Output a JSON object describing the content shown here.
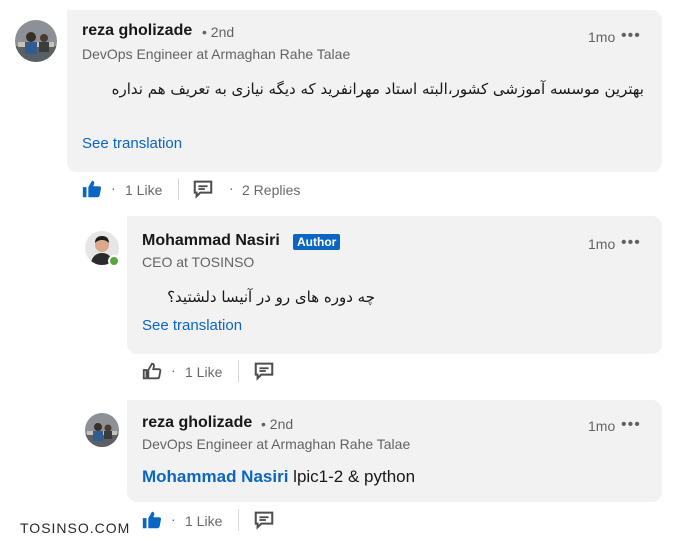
{
  "comments": [
    {
      "author": "reza gholizade",
      "degree": "• 2nd",
      "headline": "DevOps Engineer at Armaghan Rahe Talae",
      "time": "1mo",
      "more": "•••",
      "text": "بهترین موسسه آموزشی کشور،البته استاد مهرانفرید که دیگه نیازی به تعریف هم نداره",
      "translate": "See translation",
      "likes": "1 Like",
      "replies": "2 Replies"
    }
  ],
  "replies": [
    {
      "author": "Mohammad Nasiri",
      "badge": "Author",
      "headline": "CEO at TOSINSO",
      "time": "1mo",
      "more": "•••",
      "text": "چه دوره های رو در آنیسا دلشتید؟",
      "translate": "See translation",
      "likes": "1 Like"
    },
    {
      "author": "reza gholizade",
      "degree": "• 2nd",
      "headline": "DevOps Engineer at Armaghan Rahe Talae",
      "time": "1mo",
      "more": "•••",
      "mention": "Mohammad Nasiri",
      "text": "lpic1-2 & python",
      "likes": "1 Like"
    }
  ],
  "watermark": "TOSINSO.COM",
  "colors": {
    "link": "#0a66c2",
    "bubble": "#f2f2f2",
    "online": "#57a640"
  },
  "icons": {
    "like_filled": "thumbs-up-filled-icon",
    "like_outline": "thumbs-up-outline-icon",
    "reply": "comment-icon"
  }
}
